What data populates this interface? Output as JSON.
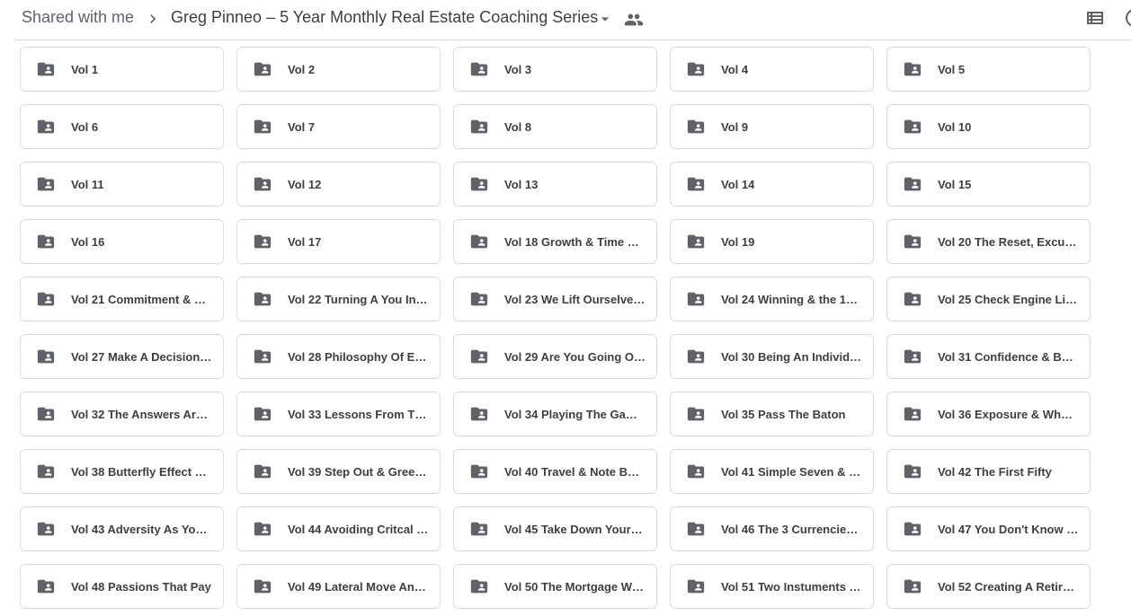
{
  "header": {
    "breadcrumb_root": "Shared with me",
    "current_folder": "Greg Pinneo – 5 Year Monthly Real Estate Coaching Series",
    "icons": {
      "separator": "chevron-right-icon",
      "caret": "caret-down-icon",
      "shared": "people-icon",
      "view_toggle": "list-view-icon"
    }
  },
  "colors": {
    "folder_icon": "#5f6368",
    "text": "#3c4043",
    "border": "#dadce0"
  },
  "folders": [
    {
      "name": "Vol 1"
    },
    {
      "name": "Vol 2"
    },
    {
      "name": "Vol 3"
    },
    {
      "name": "Vol 4"
    },
    {
      "name": "Vol 5"
    },
    {
      "name": "Vol 6"
    },
    {
      "name": "Vol 7"
    },
    {
      "name": "Vol 8"
    },
    {
      "name": "Vol 9"
    },
    {
      "name": "Vol 10"
    },
    {
      "name": "Vol 11"
    },
    {
      "name": "Vol 12"
    },
    {
      "name": "Vol 13"
    },
    {
      "name": "Vol 14"
    },
    {
      "name": "Vol 15"
    },
    {
      "name": "Vol 16"
    },
    {
      "name": "Vol 17"
    },
    {
      "name": "Vol 18 Growth & Time Ma…"
    },
    {
      "name": "Vol 19"
    },
    {
      "name": "Vol 20 The Reset, Excuse…"
    },
    {
      "name": "Vol 21 Commitment & Th…"
    },
    {
      "name": "Vol 22 Turning A You Into…"
    },
    {
      "name": "Vol 23 We Lift Ourselves …"
    },
    {
      "name": "Vol 24 Winning & the 103…"
    },
    {
      "name": "Vol 25 Check Engine Light"
    },
    {
      "name": "Vol 27 Make A Decision …"
    },
    {
      "name": "Vol 28 Philosophy Of Ext…"
    },
    {
      "name": "Vol 29 Are You Going On …"
    },
    {
      "name": "Vol 30 Being An Individu…"
    },
    {
      "name": "Vol 31 Confidence & Buyi…"
    },
    {
      "name": "Vol 32 The Answers Are …"
    },
    {
      "name": "Vol 33 Lessons From The…"
    },
    {
      "name": "Vol 34 Playing The Game…"
    },
    {
      "name": "Vol 35 Pass The Baton"
    },
    {
      "name": "Vol 36 Exposure & When …"
    },
    {
      "name": "Vol 38 Butterfly Effect & …"
    },
    {
      "name": "Vol 39 Step Out & Green …"
    },
    {
      "name": "Vol 40 Travel & Note Buyi…"
    },
    {
      "name": "Vol 41 Simple Seven & B…"
    },
    {
      "name": "Vol 42 The First Fifty"
    },
    {
      "name": "Vol 43 Adversity As Your …"
    },
    {
      "name": "Vol 44 Avoiding Critcal M…"
    },
    {
      "name": "Vol 45 Take Down Your F…"
    },
    {
      "name": "Vol 46 The 3 Currencies …"
    },
    {
      "name": "Vol 47 You Don't Know W…"
    },
    {
      "name": "Vol 48 Passions That Pay"
    },
    {
      "name": "Vol 49 Lateral Move And …"
    },
    {
      "name": "Vol 50 The Mortgage Wo…"
    },
    {
      "name": "Vol 51 Two Instuments O…"
    },
    {
      "name": "Vol 52 Creating A Retire…"
    }
  ]
}
